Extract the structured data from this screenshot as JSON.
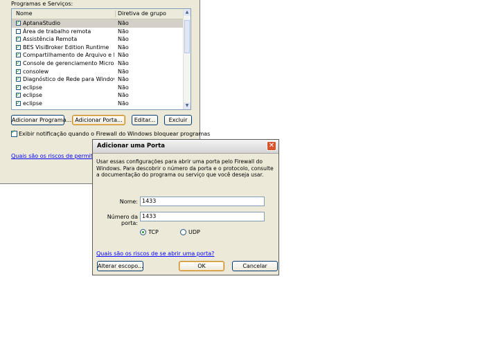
{
  "background_window": {
    "group_label": "Programas e Serviços:",
    "list": {
      "columns": [
        "Nome",
        "Diretiva de grupo"
      ],
      "rows": [
        {
          "name": "AptanaStudio",
          "policy": "Não",
          "checked": true,
          "selected": true
        },
        {
          "name": "Área de trabalho remota",
          "policy": "Não",
          "checked": false,
          "selected": false
        },
        {
          "name": "Assistência Remota",
          "policy": "Não",
          "checked": true,
          "selected": false
        },
        {
          "name": "BES VisiBroker Edition Runtime",
          "policy": "Não",
          "checked": true,
          "selected": false
        },
        {
          "name": "Compartilhamento de Arquivo e Impres...",
          "policy": "Não",
          "checked": true,
          "selected": false
        },
        {
          "name": "Console de gerenciamento Microsoft",
          "policy": "Não",
          "checked": true,
          "selected": false
        },
        {
          "name": "consolew",
          "policy": "Não",
          "checked": true,
          "selected": false
        },
        {
          "name": "Diagnóstico de Rede para Windows XP",
          "policy": "Não",
          "checked": true,
          "selected": false
        },
        {
          "name": "eclipse",
          "policy": "Não",
          "checked": true,
          "selected": false
        },
        {
          "name": "eclipse",
          "policy": "Não",
          "checked": true,
          "selected": false
        },
        {
          "name": "eclipse",
          "policy": "Não",
          "checked": true,
          "selected": false
        }
      ]
    },
    "buttons": {
      "add_program": "Adicionar Programa...",
      "add_port": "Adicionar Porta...",
      "edit": "Editar...",
      "delete": "Excluir"
    },
    "notify_checkbox_label": "Exibir notificação quando o Firewall do Windows bloquear programas",
    "notify_checked": true,
    "risk_link": "Quais são os riscos de permitir exce"
  },
  "dialog": {
    "title": "Adicionar uma Porta",
    "description": "Usar essas configurações para abrir uma porta pelo Firewall do Windows. Para descobrir o número da porta e o protocolo, consulte a documentação do programa ou serviço que você deseja usar.",
    "name_label": "Nome:",
    "name_value": "1433",
    "port_label": "Número da porta:",
    "port_value": "1433",
    "protocol_tcp": "TCP",
    "protocol_udp": "UDP",
    "selected_protocol": "TCP",
    "risk_link": "Quais são os riscos de se abrir uma porta?",
    "buttons": {
      "change_scope": "Alterar escopo...",
      "ok": "OK",
      "cancel": "Cancelar"
    },
    "close_glyph": "✕"
  }
}
